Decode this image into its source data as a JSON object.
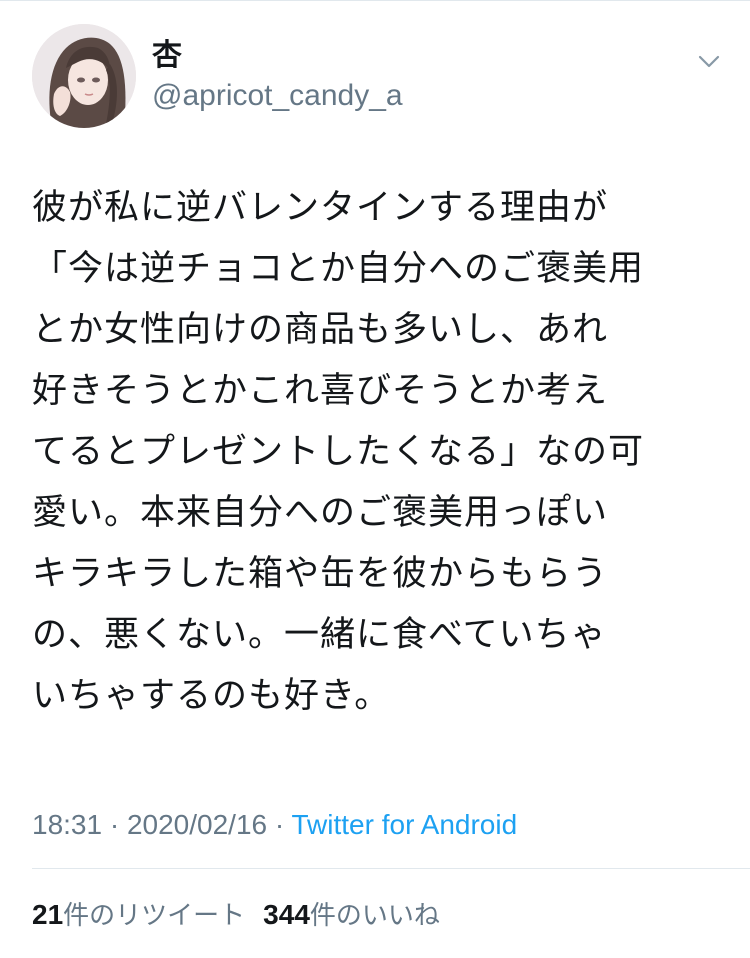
{
  "user": {
    "display_name": "杏",
    "handle": "@apricot_candy_a"
  },
  "tweet": {
    "lines": [
      "彼が私に逆バレンタインする理由が",
      "「今は逆チョコとか自分へのご褒美用",
      "とか女性向けの商品も多いし、あれ",
      "好きそうとかこれ喜びそうとか考え",
      "てるとプレゼントしたくなる」なの可",
      "愛い。本来自分へのご褒美用っぽい",
      "キラキラした箱や缶を彼からもらう",
      "の、悪くない。一緒に食べていちゃ",
      "いちゃするのも好き。"
    ]
  },
  "meta": {
    "time": "18:31",
    "separator1": " · ",
    "date": "2020/02/16",
    "separator2": " · ",
    "source": "Twitter for Android"
  },
  "stats": {
    "retweets_count": "21",
    "retweets_label": "件のリツイート",
    "likes_count": "344",
    "likes_label": "件のいいね"
  },
  "colors": {
    "text": "#14171a",
    "secondary": "#657786",
    "link": "#1da1f2",
    "divider": "#e1e8ed"
  },
  "icons": {
    "menu": "chevron-down-icon"
  }
}
